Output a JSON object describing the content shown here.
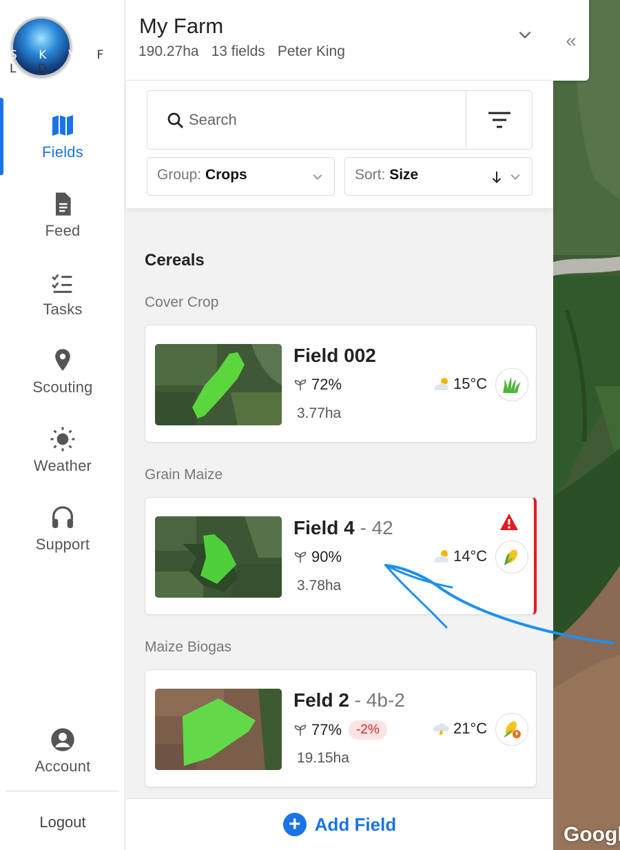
{
  "brand": {
    "logo_letters_light": "S K Y",
    "logo_letters_dark": "F L D"
  },
  "sidebar": {
    "items": [
      {
        "label": "Fields",
        "icon": "map-icon",
        "active": true
      },
      {
        "label": "Feed",
        "icon": "document-icon",
        "active": false
      },
      {
        "label": "Tasks",
        "icon": "checklist-icon",
        "active": false
      },
      {
        "label": "Scouting",
        "icon": "location-pin-icon",
        "active": false
      },
      {
        "label": "Weather",
        "icon": "sun-icon",
        "active": false
      },
      {
        "label": "Support",
        "icon": "headset-icon",
        "active": false
      }
    ],
    "account_label": "Account",
    "logout_label": "Logout"
  },
  "farm": {
    "name": "My Farm",
    "area": "190.27ha",
    "field_count": "13 fields",
    "owner": "Peter King"
  },
  "search": {
    "placeholder": "Search"
  },
  "group_dropdown": {
    "prefix": "Group:",
    "value": "Crops"
  },
  "sort_dropdown": {
    "prefix": "Sort:",
    "value": "Size"
  },
  "group_title": "Cereals",
  "subgroups": [
    {
      "label": "Cover Crop",
      "field": {
        "name": "Field 002",
        "suffix": "",
        "ndvi": "72%",
        "change": "",
        "area": "3.77ha",
        "temp": "15°C",
        "weather_icon": "partly-sunny-icon",
        "crop_icon": "grass-icon",
        "alert": false
      }
    },
    {
      "label": "Grain Maize",
      "field": {
        "name": "Field 4",
        "suffix": "- 42",
        "ndvi": "90%",
        "change": "",
        "area": "3.78ha",
        "temp": "14°C",
        "weather_icon": "partly-sunny-icon",
        "crop_icon": "corn-icon",
        "alert": true
      }
    },
    {
      "label": "Maize Biogas",
      "field": {
        "name": "Feld 2",
        "suffix": "- 4b-2",
        "ndvi": "77%",
        "change": "-2%",
        "area": "19.15ha",
        "temp": "21°C",
        "weather_icon": "thunderstorm-icon",
        "crop_icon": "corn-biogas-icon",
        "alert": false
      }
    }
  ],
  "add_field_label": "Add Field",
  "map": {
    "attribution": "Googl",
    "collapse_symbol": "«"
  },
  "colors": {
    "accent": "#1a73e8",
    "alert": "#e31b23",
    "panel_bg": "#f2f2f2"
  }
}
